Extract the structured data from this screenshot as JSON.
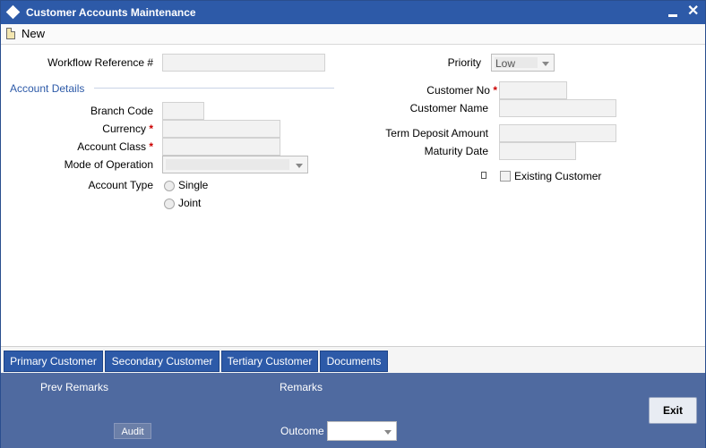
{
  "window": {
    "title": "Customer Accounts Maintenance"
  },
  "toolbar": {
    "new_label": "New"
  },
  "form": {
    "workflow_ref_label": "Workflow Reference #",
    "priority_label": "Priority",
    "priority_value": "Low",
    "section_title": "Account Details",
    "branch_code_label": "Branch Code",
    "currency_label": "Currency",
    "account_class_label": "Account Class",
    "mode_of_operation_label": "Mode of Operation",
    "account_type_label": "Account Type",
    "account_type_options": [
      "Single",
      "Joint"
    ],
    "customer_no_label": "Customer No",
    "customer_name_label": "Customer Name",
    "term_deposit_amount_label": "Term Deposit Amount",
    "maturity_date_label": "Maturity Date",
    "existing_customer_label": "Existing Customer",
    "required_mark": "*"
  },
  "tabs": [
    "Primary Customer",
    "Secondary Customer",
    "Tertiary Customer",
    "Documents"
  ],
  "footer": {
    "prev_remarks_label": "Prev Remarks",
    "remarks_label": "Remarks",
    "audit_label": "Audit",
    "outcome_label": "Outcome",
    "exit_label": "Exit"
  }
}
